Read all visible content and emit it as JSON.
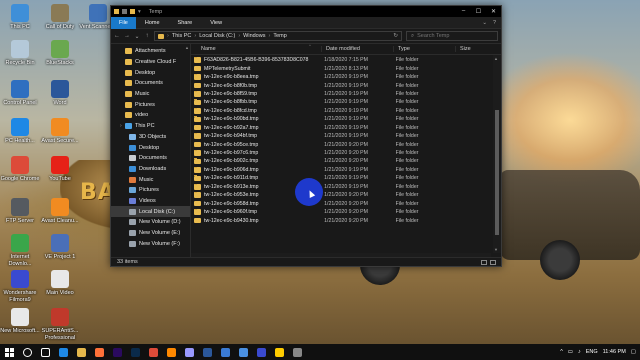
{
  "desktop": {
    "icons": [
      {
        "id": "this-pc",
        "label": "This PC",
        "color": "#3f8fd8"
      },
      {
        "id": "call-of-duty",
        "label": "Call of Duty",
        "color": "#8a7a55"
      },
      {
        "id": "vent",
        "label": "Vent Scanner...",
        "color": "#3f72b8"
      },
      {
        "id": "recycle-bin",
        "label": "Recycle Bin",
        "color": "#b4c9d9"
      },
      {
        "id": "bluestacks",
        "label": "BlueStacks",
        "color": "#6aa84f"
      },
      {
        "id": "control-panel",
        "label": "Control Panel",
        "color": "#2f6fc0"
      },
      {
        "id": "word",
        "label": "Word",
        "color": "#2b579a"
      },
      {
        "id": "pc-health",
        "label": "PC Health...",
        "color": "#1e88e5"
      },
      {
        "id": "avast",
        "label": "Avast Secure...",
        "color": "#f18b21"
      },
      {
        "id": "google-chrome",
        "label": "Google Chrome",
        "color": "#dd4b39"
      },
      {
        "id": "youtube",
        "label": "YouTube",
        "color": "#e62117"
      },
      {
        "id": "ftp-server",
        "label": "FTP Server",
        "color": "#555a60"
      },
      {
        "id": "avast-cleanup",
        "label": "Avast Cleanu...",
        "color": "#f18b21"
      },
      {
        "id": "internet-downloader",
        "label": "Internet Downlo...",
        "color": "#3aa64a"
      },
      {
        "id": "ve-project",
        "label": "VE Project 1",
        "color": "#4a6fb8"
      },
      {
        "id": "wondershare-filmora",
        "label": "Wondershare Filmora9",
        "color": "#3a4ad0"
      },
      {
        "id": "main-video",
        "label": "Main Video",
        "color": "#e8e8e8"
      },
      {
        "id": "new-microsoft",
        "label": "New Microsoft...",
        "color": "#e8e8e8"
      },
      {
        "id": "superantispyware",
        "label": "SUPERAntiS... Professional",
        "color": "#c0392b"
      }
    ],
    "wallpaper_text": "BATT"
  },
  "window": {
    "title": "Temp",
    "ribbon_tabs": [
      "File",
      "Home",
      "Share",
      "View"
    ],
    "address": {
      "segments": [
        "This PC",
        "Local Disk (C:)",
        "Windows",
        "Temp"
      ],
      "separator": "›"
    },
    "search": {
      "placeholder": "Search Temp"
    },
    "columns": {
      "name": "Name",
      "date": "Date modified",
      "type": "Type",
      "size": "Size"
    },
    "nav_items": [
      {
        "label": "Attachments",
        "type": "folder",
        "indent": false
      },
      {
        "label": "Creative Cloud F",
        "type": "folder",
        "indent": false
      },
      {
        "label": "Desktop",
        "type": "folder",
        "indent": false
      },
      {
        "label": "Documents",
        "type": "folder",
        "indent": false
      },
      {
        "label": "Music",
        "type": "folder",
        "indent": false
      },
      {
        "label": "Pictures",
        "type": "folder",
        "indent": false
      },
      {
        "label": "video",
        "type": "folder",
        "indent": false
      },
      {
        "label": "This PC",
        "type": "pc",
        "indent": false
      },
      {
        "label": "3D Objects",
        "type": "3d",
        "indent": true
      },
      {
        "label": "Desktop",
        "type": "desktop",
        "indent": true
      },
      {
        "label": "Documents",
        "type": "docs",
        "indent": true
      },
      {
        "label": "Downloads",
        "type": "downloads",
        "indent": true
      },
      {
        "label": "Music",
        "type": "music",
        "indent": true
      },
      {
        "label": "Pictures",
        "type": "pictures",
        "indent": true
      },
      {
        "label": "Videos",
        "type": "videos",
        "indent": true
      },
      {
        "label": "Local Disk (C:)",
        "type": "disk",
        "indent": true,
        "selected": true
      },
      {
        "label": "New Volume (D:)",
        "type": "disk",
        "indent": true
      },
      {
        "label": "New Volume (E:)",
        "type": "disk",
        "indent": true
      },
      {
        "label": "New Volume (F:)",
        "type": "disk",
        "indent": true
      }
    ],
    "files": [
      {
        "name": "F63AD826-B821-45B6-B396-853783D8C078",
        "date": "1/18/2020 7:15 PM",
        "type": "File folder"
      },
      {
        "name": "MPTelemetrySubmit",
        "date": "1/21/2020 8:13 PM",
        "type": "File folder"
      },
      {
        "name": "tw-12ec-e9c-b8eea.tmp",
        "date": "1/21/2020 9:19 PM",
        "type": "File folder"
      },
      {
        "name": "tw-12ec-e9c-b8f0b.tmp",
        "date": "1/21/2020 9:19 PM",
        "type": "File folder"
      },
      {
        "name": "tw-12ec-e9c-b8f59.tmp",
        "date": "1/21/2020 9:19 PM",
        "type": "File folder"
      },
      {
        "name": "tw-12ec-e9c-b8fbb.tmp",
        "date": "1/21/2020 9:19 PM",
        "type": "File folder"
      },
      {
        "name": "tw-12ec-e9c-b8fcd.tmp",
        "date": "1/21/2020 9:19 PM",
        "type": "File folder"
      },
      {
        "name": "tw-12ec-e9c-b90bd.tmp",
        "date": "1/21/2020 9:19 PM",
        "type": "File folder"
      },
      {
        "name": "tw-12ec-e9c-b92a7.tmp",
        "date": "1/21/2020 9:19 PM",
        "type": "File folder"
      },
      {
        "name": "tw-12ec-e9c-b94bf.tmp",
        "date": "1/21/2020 9:19 PM",
        "type": "File folder"
      },
      {
        "name": "tw-12ec-e9c-b95ce.tmp",
        "date": "1/21/2020 9:20 PM",
        "type": "File folder"
      },
      {
        "name": "tw-12ec-e9c-b97c6.tmp",
        "date": "1/21/2020 9:20 PM",
        "type": "File folder"
      },
      {
        "name": "tw-12ec-e9c-b902c.tmp",
        "date": "1/21/2020 9:20 PM",
        "type": "File folder"
      },
      {
        "name": "tw-12ec-e9c-b906d.tmp",
        "date": "1/21/2020 9:19 PM",
        "type": "File folder"
      },
      {
        "name": "tw-12ec-e9c-b911d.tmp",
        "date": "1/21/2020 9:19 PM",
        "type": "File folder"
      },
      {
        "name": "tw-12ec-e9c-b913e.tmp",
        "date": "1/21/2020 9:19 PM",
        "type": "File folder"
      },
      {
        "name": "tw-12ec-e9c-b953e.tmp",
        "date": "1/21/2020 9:20 PM",
        "type": "File folder"
      },
      {
        "name": "tw-12ec-e9c-b958d.tmp",
        "date": "1/21/2020 9:20 PM",
        "type": "File folder"
      },
      {
        "name": "tw-12ec-e9c-b960f.tmp",
        "date": "1/21/2020 9:20 PM",
        "type": "File folder"
      },
      {
        "name": "tw-12ec-e9c-b9430.tmp",
        "date": "1/21/2020 9:20 PM",
        "type": "File folder"
      }
    ],
    "status": {
      "count": "33 items"
    }
  },
  "taskbar": {
    "apps": [
      {
        "id": "search",
        "color": "#ffffff"
      },
      {
        "id": "task-view",
        "color": "#ffffff"
      },
      {
        "id": "edge",
        "color": "#1e88e5"
      },
      {
        "id": "file-explorer",
        "color": "#e6b84c"
      },
      {
        "id": "firefox",
        "color": "#ff7139"
      },
      {
        "id": "adobe-premiere",
        "color": "#2a0a5e"
      },
      {
        "id": "adobe-photoshop",
        "color": "#0a2a4a"
      },
      {
        "id": "chrome",
        "color": "#dd4b39"
      },
      {
        "id": "vlc",
        "color": "#ff8800"
      },
      {
        "id": "premiere-pro",
        "color": "#9999ff"
      },
      {
        "id": "word",
        "color": "#2b579a"
      },
      {
        "id": "photos",
        "color": "#3a7bd5"
      },
      {
        "id": "store",
        "color": "#4a90e2"
      },
      {
        "id": "filmora",
        "color": "#3a4ad0"
      },
      {
        "id": "ve-app",
        "color": "#ffcc00"
      },
      {
        "id": "tiles",
        "color": "#888888"
      }
    ],
    "tray": {
      "language": "ENG",
      "time": "11:46 PM"
    }
  }
}
